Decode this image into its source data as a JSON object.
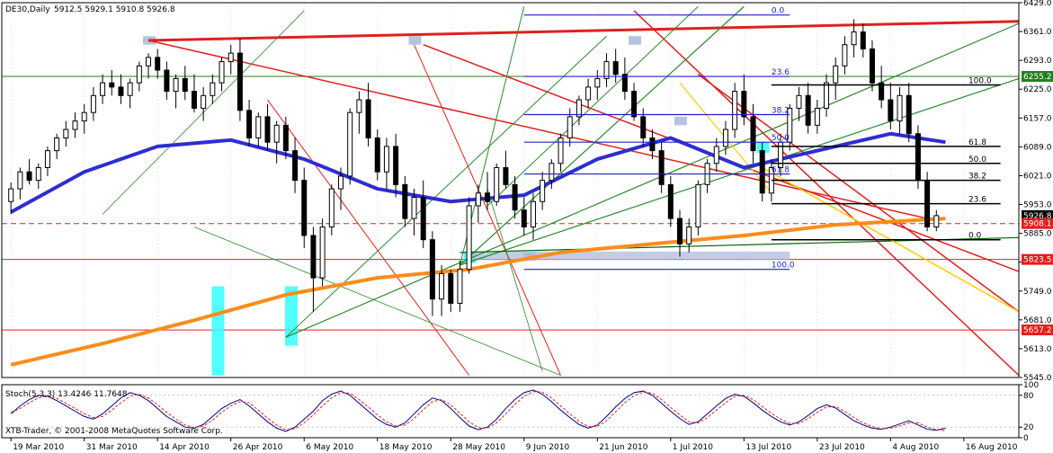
{
  "header": {
    "symbol": "DE30,Daily",
    "ohlc": "5912.5 5929.1 5910.8 5926.8"
  },
  "footer": {
    "watermark": "XTB-Trader, © 2001-2008 MetaQuotes Software Corp."
  },
  "colors": {
    "background": "#ffffff",
    "grid": "#c0c0c0",
    "bull_candle": "#ffffff",
    "bear_candle": "#000000",
    "ma_fast": "#2d2dd2",
    "ma_slow": "#ff8c1a",
    "trend_red": "#e02020",
    "trend_green": "#2a8a2a",
    "fib_blue": "#2020c0",
    "highlight_cyan": "#33ffff",
    "highlight_gray": "#a8b8d8"
  },
  "chart_data": [
    {
      "type": "candlestick",
      "title": "DE30,Daily",
      "ylim": [
        5545.0,
        6429.0
      ],
      "y_ticks": [
        "6429.0",
        "6361.0",
        "6293.0",
        "6225.0",
        "6157.0",
        "6089.0",
        "6021.0",
        "5953.0",
        "5885.0",
        "5817.0",
        "5749.0",
        "5681.0",
        "5613.0",
        "5545.0"
      ],
      "x_tick_labels": [
        "19 Mar 2010",
        "31 Mar 2010",
        "14 Apr 2010",
        "26 Apr 2010",
        "6 May 2010",
        "18 May 2010",
        "28 May 2010",
        "9 Jun 2010",
        "21 Jun 2010",
        "1 Jul 2010",
        "13 Jul 2010",
        "23 Jul 2010",
        "4 Aug 2010",
        "16 Aug 2010"
      ],
      "price_badges": [
        {
          "value": "6255.2",
          "color": "#208020"
        },
        {
          "value": "5926.8",
          "color": "#000000"
        },
        {
          "value": "5908.1",
          "color": "#e02020"
        },
        {
          "value": "5823.5",
          "color": "#e02020"
        },
        {
          "value": "5657.2",
          "color": "#e02020"
        }
      ],
      "horizontal_levels": [
        {
          "value": 6255.2,
          "color": "#208020"
        },
        {
          "value": 5908.1,
          "color": "#e02020",
          "dashed": true
        },
        {
          "value": 5823.5,
          "color": "#e02020"
        },
        {
          "value": 5657.2,
          "color": "#e02020"
        }
      ],
      "fib_blue_labels": [
        "0.0",
        "23.6",
        "38.2",
        "50.0",
        "61.8",
        "100.0"
      ],
      "fib_black_labels": [
        "100.0",
        "61.8",
        "50.0",
        "38.2",
        "23.6",
        "0.0"
      ],
      "candles": [
        [
          5960,
          6005,
          5930,
          5990
        ],
        [
          5990,
          6040,
          5965,
          6030
        ],
        [
          6030,
          6060,
          6000,
          6010
        ],
        [
          6010,
          6050,
          5990,
          6040
        ],
        [
          6040,
          6090,
          6020,
          6080
        ],
        [
          6080,
          6120,
          6060,
          6110
        ],
        [
          6110,
          6150,
          6090,
          6130
        ],
        [
          6130,
          6170,
          6110,
          6150
        ],
        [
          6150,
          6190,
          6120,
          6170
        ],
        [
          6170,
          6230,
          6150,
          6210
        ],
        [
          6210,
          6260,
          6190,
          6240
        ],
        [
          6240,
          6270,
          6210,
          6230
        ],
        [
          6230,
          6260,
          6190,
          6210
        ],
        [
          6210,
          6250,
          6180,
          6240
        ],
        [
          6240,
          6290,
          6220,
          6280
        ],
        [
          6280,
          6310,
          6250,
          6300
        ],
        [
          6300,
          6320,
          6250,
          6270
        ],
        [
          6270,
          6290,
          6200,
          6220
        ],
        [
          6220,
          6260,
          6180,
          6250
        ],
        [
          6250,
          6280,
          6200,
          6220
        ],
        [
          6220,
          6260,
          6170,
          6180
        ],
        [
          6180,
          6230,
          6150,
          6210
        ],
        [
          6210,
          6260,
          6190,
          6240
        ],
        [
          6240,
          6300,
          6220,
          6290
        ],
        [
          6290,
          6330,
          6260,
          6310
        ],
        [
          6310,
          6345,
          6150,
          6175
        ],
        [
          6175,
          6200,
          6090,
          6110
        ],
        [
          6110,
          6170,
          6090,
          6160
        ],
        [
          6160,
          6190,
          6080,
          6100
        ],
        [
          6100,
          6150,
          6050,
          6140
        ],
        [
          6140,
          6160,
          6060,
          6080
        ],
        [
          6080,
          6110,
          5980,
          6010
        ],
        [
          6010,
          6040,
          5850,
          5880
        ],
        [
          5880,
          5900,
          5700,
          5780
        ],
        [
          5780,
          5920,
          5760,
          5900
        ],
        [
          5900,
          6000,
          5880,
          5990
        ],
        [
          5990,
          6040,
          5940,
          6020
        ],
        [
          6020,
          6180,
          6000,
          6170
        ],
        [
          6170,
          6220,
          6120,
          6200
        ],
        [
          6200,
          6240,
          6090,
          6110
        ],
        [
          6110,
          6130,
          6010,
          6030
        ],
        [
          6030,
          6110,
          5990,
          6090
        ],
        [
          6090,
          6120,
          5970,
          6000
        ],
        [
          6000,
          6020,
          5900,
          5920
        ],
        [
          5920,
          5990,
          5880,
          5970
        ],
        [
          5970,
          6010,
          5850,
          5870
        ],
        [
          5870,
          5890,
          5690,
          5730
        ],
        [
          5730,
          5810,
          5690,
          5790
        ],
        [
          5790,
          5800,
          5700,
          5720
        ],
        [
          5720,
          5820,
          5700,
          5800
        ],
        [
          5800,
          5970,
          5790,
          5950
        ],
        [
          5950,
          6000,
          5910,
          5980
        ],
        [
          5980,
          6030,
          5940,
          5960
        ],
        [
          5960,
          6050,
          5950,
          6040
        ],
        [
          6040,
          6080,
          5990,
          6000
        ],
        [
          6000,
          6020,
          5920,
          5940
        ],
        [
          5940,
          5970,
          5880,
          5900
        ],
        [
          5900,
          5980,
          5870,
          5960
        ],
        [
          5960,
          6030,
          5940,
          6010
        ],
        [
          6010,
          6060,
          5990,
          6050
        ],
        [
          6050,
          6120,
          6030,
          6110
        ],
        [
          6110,
          6180,
          6090,
          6160
        ],
        [
          6160,
          6210,
          6140,
          6200
        ],
        [
          6200,
          6250,
          6180,
          6230
        ],
        [
          6230,
          6270,
          6200,
          6250
        ],
        [
          6250,
          6310,
          6230,
          6290
        ],
        [
          6290,
          6320,
          6240,
          6260
        ],
        [
          6260,
          6300,
          6200,
          6220
        ],
        [
          6220,
          6240,
          6150,
          6160
        ],
        [
          6160,
          6180,
          6090,
          6110
        ],
        [
          6110,
          6130,
          6060,
          6080
        ],
        [
          6080,
          6100,
          5980,
          6000
        ],
        [
          6000,
          6020,
          5900,
          5920
        ],
        [
          5920,
          5940,
          5830,
          5860
        ],
        [
          5860,
          5920,
          5840,
          5900
        ],
        [
          5900,
          6010,
          5880,
          6000
        ],
        [
          6000,
          6060,
          5980,
          6050
        ],
        [
          6050,
          6110,
          6030,
          6090
        ],
        [
          6090,
          6150,
          6070,
          6130
        ],
        [
          6130,
          6240,
          6110,
          6220
        ],
        [
          6220,
          6260,
          6140,
          6160
        ],
        [
          6160,
          6190,
          6050,
          6080
        ],
        [
          6080,
          6100,
          5960,
          5980
        ],
        [
          5980,
          6060,
          5960,
          6040
        ],
        [
          6040,
          6120,
          6020,
          6100
        ],
        [
          6100,
          6190,
          6080,
          6180
        ],
        [
          6180,
          6230,
          6150,
          6210
        ],
        [
          6210,
          6240,
          6120,
          6140
        ],
        [
          6140,
          6200,
          6120,
          6180
        ],
        [
          6180,
          6260,
          6160,
          6240
        ],
        [
          6240,
          6300,
          6200,
          6280
        ],
        [
          6280,
          6350,
          6260,
          6330
        ],
        [
          6330,
          6390,
          6300,
          6360
        ],
        [
          6360,
          6380,
          6300,
          6320
        ],
        [
          6320,
          6340,
          6220,
          6240
        ],
        [
          6240,
          6280,
          6180,
          6200
        ],
        [
          6200,
          6240,
          6130,
          6150
        ],
        [
          6150,
          6230,
          6120,
          6210
        ],
        [
          6210,
          6240,
          6100,
          6120
        ],
        [
          6120,
          6140,
          5990,
          6010
        ],
        [
          6010,
          6030,
          5890,
          5900
        ],
        [
          5900,
          5940,
          5890,
          5926.8
        ]
      ],
      "series": [
        {
          "name": "",
          "color": "#2d2dd2",
          "x": [
            0,
            8,
            16,
            24,
            32,
            40,
            48,
            56,
            64,
            72,
            80,
            88,
            96,
            102
          ],
          "values": [
            5935,
            6030,
            6090,
            6105,
            6060,
            5990,
            5960,
            5975,
            6060,
            6110,
            6040,
            6080,
            6120,
            6100
          ]
        },
        {
          "name": "",
          "color": "#ff8c1a",
          "x": [
            0,
            10,
            20,
            30,
            40,
            50,
            60,
            70,
            80,
            90,
            102
          ],
          "values": [
            5575,
            5625,
            5680,
            5740,
            5780,
            5800,
            5840,
            5860,
            5880,
            5905,
            5920
          ]
        }
      ],
      "x_range": [
        -1,
        110
      ]
    },
    {
      "type": "line",
      "title": "Stoch(5,3,3) 13.4246 11.7648",
      "ylim": [
        0,
        100
      ],
      "y_ticks": [
        "100",
        "80",
        "20",
        "0"
      ],
      "series": [
        {
          "name": "",
          "color": "#000080",
          "values": [
            45,
            60,
            72,
            80,
            78,
            70,
            60,
            50,
            40,
            35,
            45,
            60,
            75,
            85,
            80,
            70,
            55,
            40,
            30,
            20,
            18,
            25,
            40,
            55,
            65,
            72,
            60,
            45,
            30,
            18,
            12,
            20,
            35,
            50,
            70,
            82,
            88,
            80,
            65,
            50,
            35,
            25,
            20,
            28,
            45,
            62,
            75,
            70,
            55,
            38,
            22,
            15,
            20,
            35,
            55,
            72,
            85,
            90,
            82,
            68,
            52,
            38,
            25,
            18,
            24,
            40,
            58,
            74,
            85,
            88,
            80,
            65,
            50,
            36,
            25,
            30,
            45,
            60,
            74,
            82,
            78,
            66,
            52,
            40,
            30,
            24,
            30,
            42,
            55,
            62,
            56,
            44,
            32,
            24,
            18,
            16,
            20,
            26,
            32,
            24,
            16,
            14,
            18
          ]
        },
        {
          "name": "",
          "color": "#e02020",
          "values": [
            48,
            55,
            66,
            75,
            79,
            74,
            65,
            55,
            45,
            38,
            40,
            52,
            66,
            78,
            82,
            75,
            62,
            48,
            35,
            24,
            19,
            22,
            33,
            48,
            60,
            68,
            66,
            52,
            37,
            24,
            15,
            17,
            28,
            43,
            60,
            75,
            85,
            84,
            72,
            58,
            43,
            30,
            22,
            24,
            36,
            53,
            68,
            72,
            62,
            46,
            30,
            19,
            18,
            28,
            45,
            63,
            78,
            87,
            86,
            75,
            60,
            45,
            31,
            21,
            21,
            32,
            49,
            66,
            79,
            86,
            84,
            72,
            57,
            43,
            30,
            28,
            38,
            52,
            66,
            78,
            80,
            72,
            59,
            46,
            35,
            27,
            27,
            36,
            48,
            58,
            59,
            50,
            38,
            28,
            21,
            17,
            18,
            22,
            28,
            28,
            20,
            15,
            13.4
          ]
        }
      ]
    }
  ]
}
